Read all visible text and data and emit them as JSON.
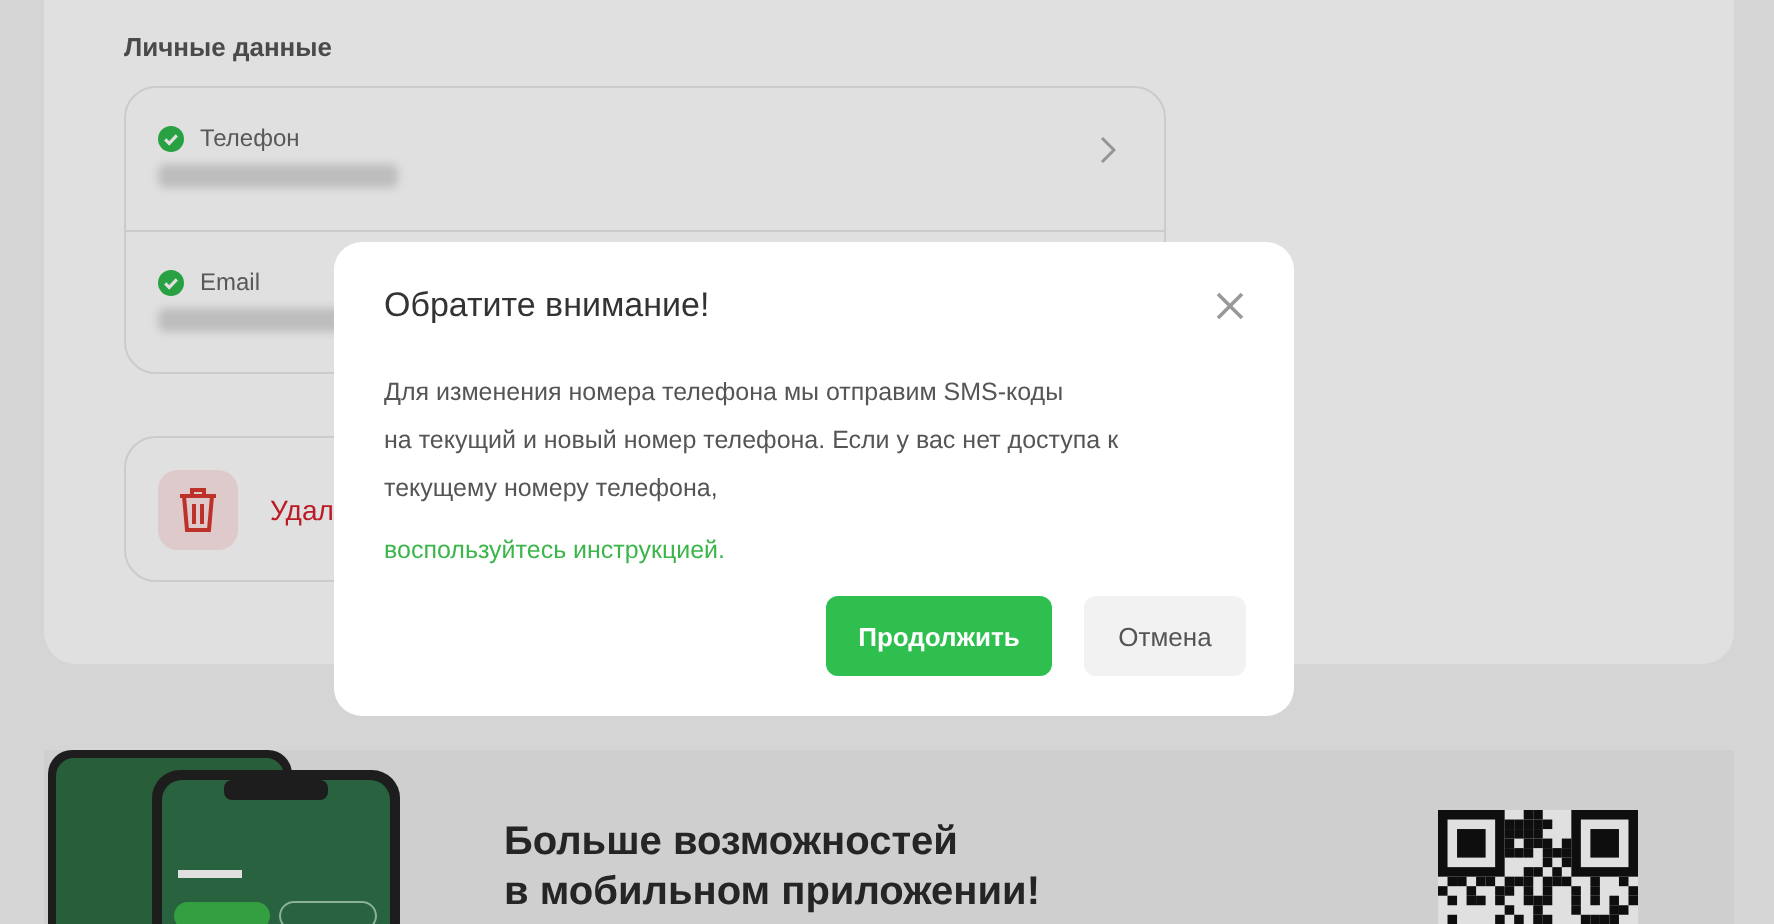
{
  "section_title": "Личные данные",
  "contacts": [
    {
      "label": "Телефон",
      "verified": true,
      "has_arrow": true
    },
    {
      "label": "Email",
      "verified": true,
      "has_arrow": false
    }
  ],
  "delete_account": {
    "label": "Удал"
  },
  "dialog": {
    "title": "Обратите внимание!",
    "body_lines": [
      "Для изменения номера телефона мы отправим SMS-коды",
      "на текущий и новый номер телефона. Если у вас нет доступа к",
      "текущему номеру телефона,"
    ],
    "link": "воспользуйтесь инструкцией.",
    "buttons": [
      {
        "label": "Продолжить",
        "kind": "primary"
      },
      {
        "label": "Отмена",
        "kind": "secondary"
      }
    ]
  },
  "promo": {
    "title_lines": [
      "Больше возможностей",
      "в мобильном приложении!"
    ]
  }
}
